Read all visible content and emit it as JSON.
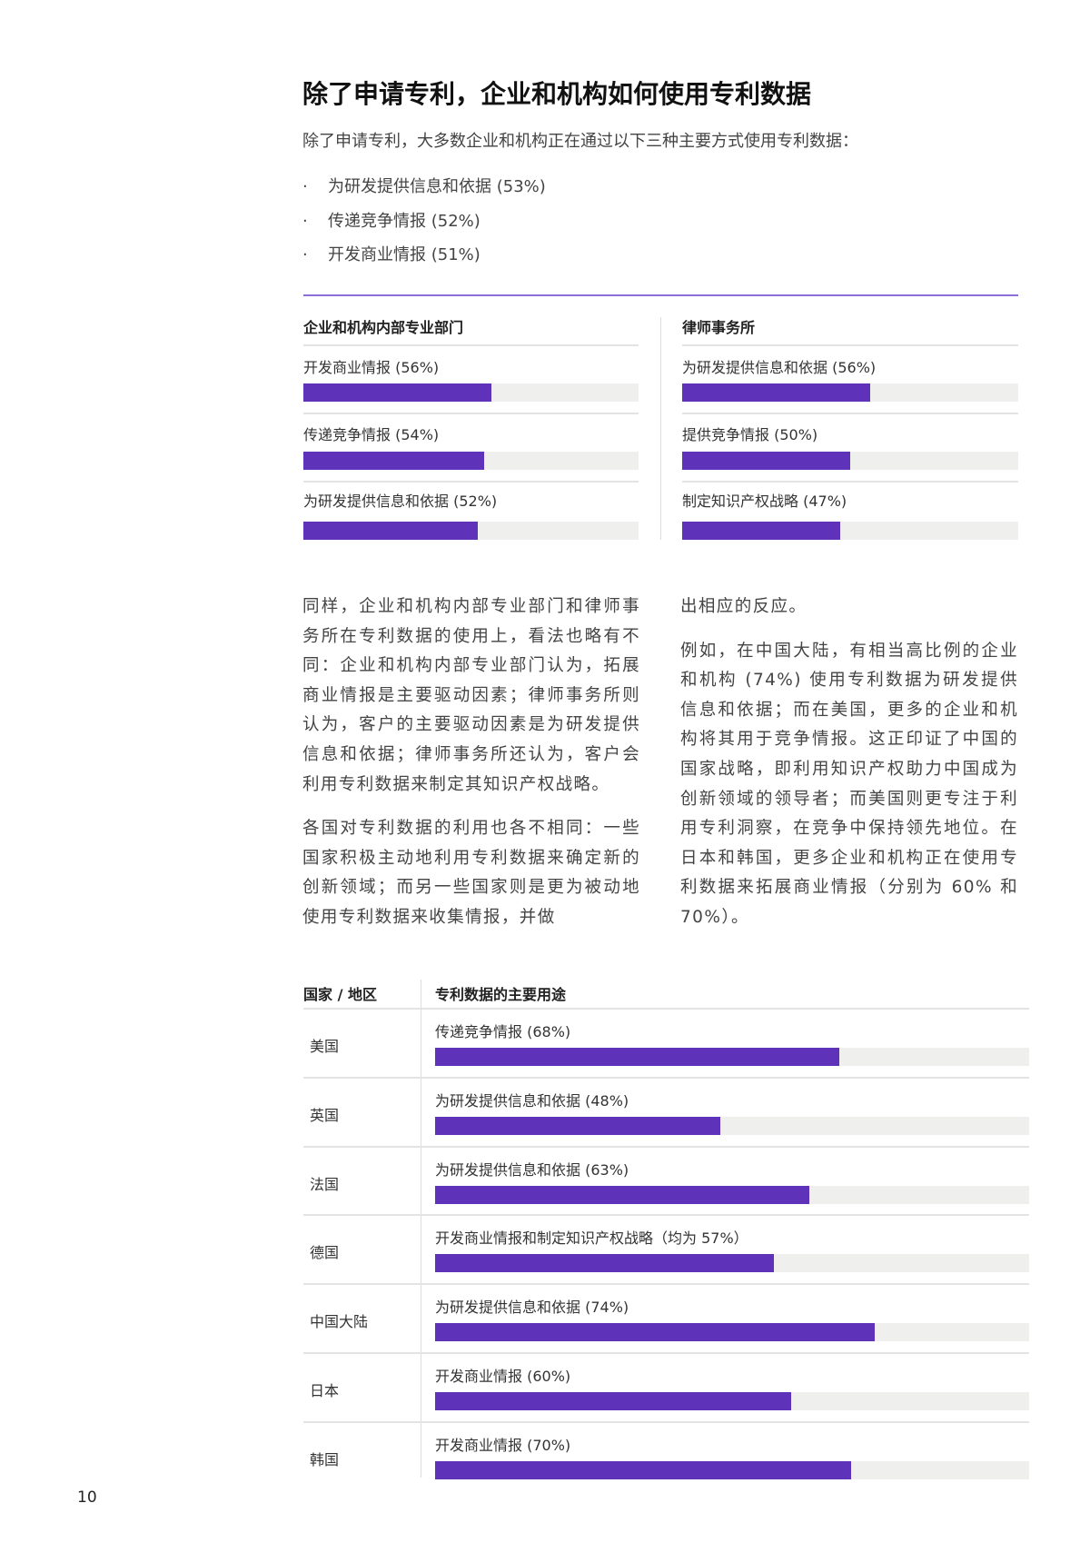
{
  "title": "除了申请专利，企业和机构如何使用专利数据",
  "intro": "除了申请专利，大多数企业和机构正在通过以下三种主要方式使用专利数据：",
  "bullets": [
    "为研发提供信息和依据 (53%)",
    "传递竞争情报 (52%)",
    "开发商业情报 (51%)"
  ],
  "bullet_marker": "·",
  "colors": {
    "accent": "#5e33b9",
    "track": "#efefed",
    "rule": "#8a6ed8"
  },
  "panels": [
    {
      "heading": "企业和机构内部专业部门",
      "items": [
        {
          "label": "开发商业情报 (56%)",
          "value": 56
        },
        {
          "label": "传递竞争情报 (54%)",
          "value": 54
        },
        {
          "label": "为研发提供信息和依据 (52%)",
          "value": 52
        }
      ]
    },
    {
      "heading": "律师事务所",
      "items": [
        {
          "label": "为研发提供信息和依据 (56%)",
          "value": 56
        },
        {
          "label": "提供竞争情报 (50%)",
          "value": 50
        },
        {
          "label": "制定知识产权战略 (47%)",
          "value": 47
        }
      ]
    }
  ],
  "body_left": [
    "同样，企业和机构内部专业部门和律师事务所在专利数据的使用上，看法也略有不同：企业和机构内部专业部门认为，拓展商业情报是主要驱动因素；律师事务所则认为，客户的主要驱动因素是为研发提供信息和依据；律师事务所还认为，客户会利用专利数据来制定其知识产权战略。",
    "各国对专利数据的利用也各不相同：一些国家积极主动地利用专利数据来确定新的创新领域；而另一些国家则是更为被动地使用专利数据来收集情报，并做"
  ],
  "body_right": [
    "出相应的反应。",
    "例如，在中国大陆，有相当高比例的企业和机构 (74%) 使用专利数据为研发提供信息和依据；而在美国，更多的企业和机构将其用于竞争情报。这正印证了中国的国家战略，即利用知识产权助力中国成为创新领域的领导者；而美国则更专注于利用专利洞察，在竞争中保持领先地位。在日本和韩国，更多企业和机构正在使用专利数据来拓展商业情报（分别为 60% 和 70%）。"
  ],
  "table": {
    "headers": [
      "国家 / 地区",
      "专利数据的主要用途"
    ],
    "rows": [
      {
        "country": "美国",
        "label": "传递竞争情报 (68%)",
        "value": 68
      },
      {
        "country": "英国",
        "label": "为研发提供信息和依据 (48%)",
        "value": 48
      },
      {
        "country": "法国",
        "label": "为研发提供信息和依据 (63%)",
        "value": 63
      },
      {
        "country": "德国",
        "label": "开发商业情报和制定知识产权战略（均为 57%）",
        "value": 57
      },
      {
        "country": "中国大陆",
        "label": "为研发提供信息和依据 (74%)",
        "value": 74
      },
      {
        "country": "日本",
        "label": "开发商业情报 (60%)",
        "value": 60
      },
      {
        "country": "韩国",
        "label": "开发商业情报 (70%)",
        "value": 70
      }
    ]
  },
  "page_number": "10"
}
